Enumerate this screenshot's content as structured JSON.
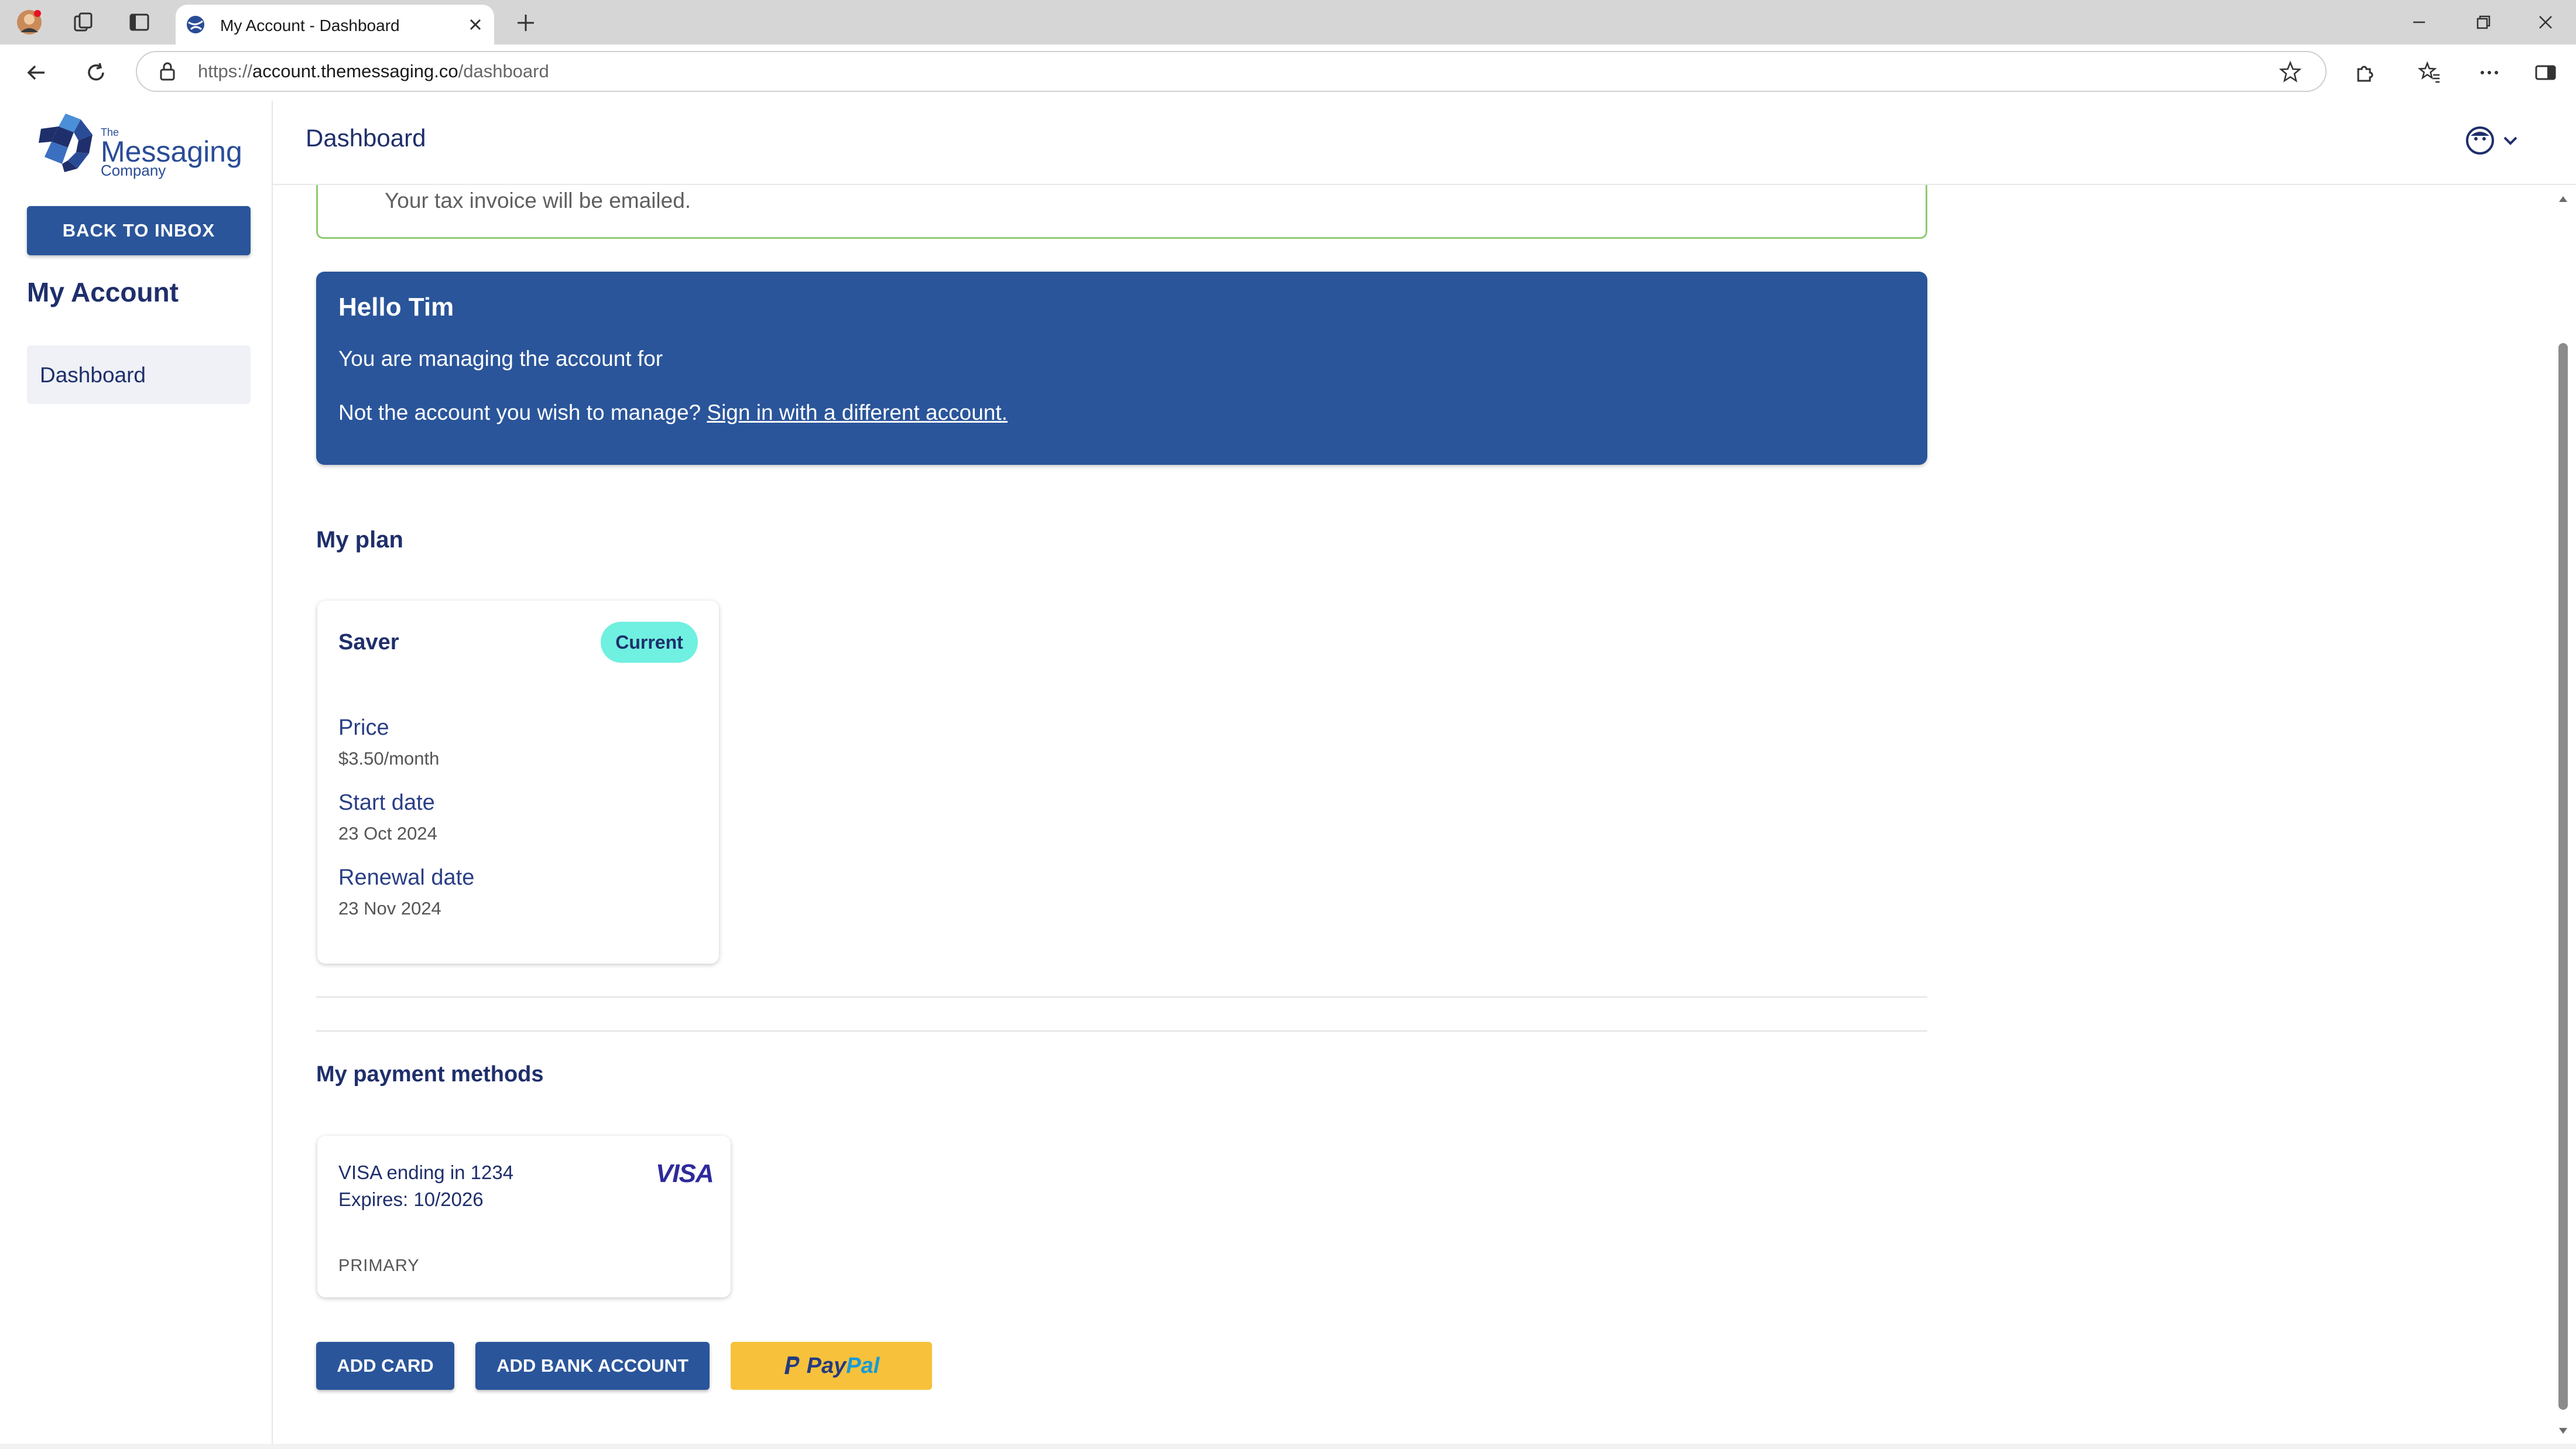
{
  "browser": {
    "tab_title": "My Account - Dashboard",
    "url_prefix": "https://",
    "url_host": "account.themessaging.co",
    "url_path": "/dashboard"
  },
  "sidebar": {
    "logo_the": "The",
    "logo_main": "Messaging",
    "logo_company": "Company",
    "back_button": "BACK TO INBOX",
    "section_title": "My Account",
    "items": [
      {
        "label": "Dashboard"
      }
    ]
  },
  "header": {
    "title": "Dashboard"
  },
  "notice": {
    "text": "Your tax invoice will be emailed."
  },
  "hello": {
    "title": "Hello Tim",
    "managing_text": "You are managing the account for",
    "not_account_text": "Not the account you wish to manage?",
    "link_text": "Sign in with a different account."
  },
  "plan": {
    "section_title": "My plan",
    "name": "Saver",
    "badge": "Current",
    "price_label": "Price",
    "price_value": "$3.50/month",
    "start_label": "Start date",
    "start_value": "23 Oct 2024",
    "renewal_label": "Renewal date",
    "renewal_value": "23 Nov 2024"
  },
  "payment": {
    "section_title": "My payment methods",
    "card_text": "VISA ending in 1234",
    "expires_text": "Expires: 10/2026",
    "primary_text": "PRIMARY",
    "brand_logo_text": "VISA",
    "add_card": "ADD CARD",
    "add_bank": "ADD BANK ACCOUNT",
    "paypal_pay": "Pay",
    "paypal_pal": "Pal"
  },
  "colors": {
    "primary": "#2a559a",
    "heading": "#1f2f6b",
    "badge": "#6ff0e0",
    "notice_border": "#8fcb72",
    "paypal": "#f7c13b"
  },
  "icons": [
    "profile-icon",
    "collections-icon",
    "tab-actions-icon",
    "globe-icon",
    "close-icon",
    "plus-icon",
    "minimize-icon",
    "restore-icon",
    "back-icon",
    "refresh-icon",
    "lock-icon",
    "star-icon",
    "extensions-icon",
    "favorites-icon",
    "more-icon",
    "sidebar-icon",
    "avatar-icon",
    "chevron-down-icon"
  ]
}
